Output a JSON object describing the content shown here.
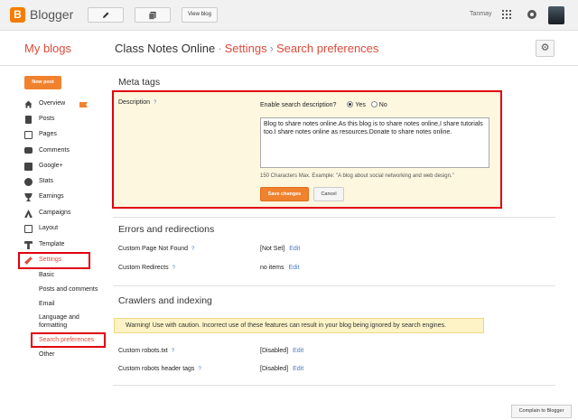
{
  "topbar": {
    "app_name": "Blogger",
    "logo_letter": "B",
    "edit_icon": "pencil-icon",
    "posts_icon": "stack-icon",
    "view_blog_label": "View blog",
    "user_name": "Tanmay"
  },
  "header": {
    "my_blogs": "My blogs",
    "blog_name": "Class Notes Online",
    "sep1": "·",
    "crumb1": "Settings",
    "sep2": "›",
    "crumb2": "Search preferences"
  },
  "sidebar": {
    "new_post": "New post",
    "items": [
      {
        "label": "Overview",
        "icon": "home-icon"
      },
      {
        "label": "Posts",
        "icon": "document-icon"
      },
      {
        "label": "Pages",
        "icon": "pages-icon"
      },
      {
        "label": "Comments",
        "icon": "comment-icon"
      },
      {
        "label": "Google+",
        "icon": "google-plus-icon"
      },
      {
        "label": "Stats",
        "icon": "pie-chart-icon"
      },
      {
        "label": "Earnings",
        "icon": "trophy-icon"
      },
      {
        "label": "Campaigns",
        "icon": "campaign-icon"
      },
      {
        "label": "Layout",
        "icon": "layout-icon"
      },
      {
        "label": "Template",
        "icon": "template-icon"
      },
      {
        "label": "Settings",
        "icon": "wrench-icon"
      }
    ],
    "sub_items": [
      "Basic",
      "Posts and comments",
      "Email",
      "Language and",
      "formatting",
      "Search preferences",
      "Other"
    ]
  },
  "meta_tags": {
    "title": "Meta tags",
    "description_label": "Description",
    "help": "?",
    "enable_label": "Enable search description?",
    "yes": "Yes",
    "no": "No",
    "description_value": "Blog to share notes online.As this blog is to share notes online,I share tutorials too.I share notes online as resources.Donate to share notes online.",
    "hint": "150 Characters Max. Example: \"A blog about social networking and web design.\"",
    "save": "Save changes",
    "cancel": "Cancel"
  },
  "errors": {
    "title": "Errors and redirections",
    "rows": [
      {
        "label": "Custom Page Not Found",
        "value": "[Not Set]",
        "edit": "Edit"
      },
      {
        "label": "Custom Redirects",
        "value": "no items",
        "edit": "Edit"
      }
    ]
  },
  "crawlers": {
    "title": "Crawlers and indexing",
    "warning": "Warning! Use with caution. Incorrect use of these features can result in your blog being ignored by search engines.",
    "rows": [
      {
        "label": "Custom robots.txt",
        "value": "[Disabled]",
        "edit": "Edit"
      },
      {
        "label": "Custom robots header tags",
        "value": "[Disabled]",
        "edit": "Edit"
      }
    ]
  },
  "footer": {
    "complain": "Complain to Blogger"
  },
  "colors": {
    "accent": "#dd4b39",
    "button_orange": "#f0822e",
    "highlight_red": "#e0000f",
    "panel_yellow": "#fdf7e0"
  }
}
